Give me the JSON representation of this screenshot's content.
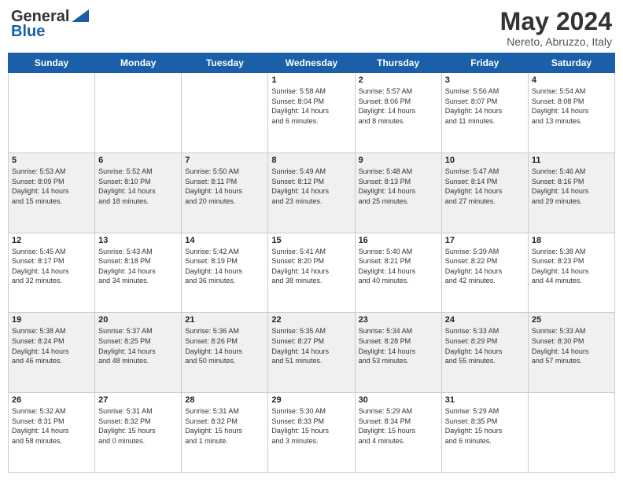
{
  "header": {
    "logo_general": "General",
    "logo_blue": "Blue",
    "month_title": "May 2024",
    "location": "Nereto, Abruzzo, Italy"
  },
  "weekdays": [
    "Sunday",
    "Monday",
    "Tuesday",
    "Wednesday",
    "Thursday",
    "Friday",
    "Saturday"
  ],
  "weeks": [
    {
      "shaded": false,
      "days": [
        {
          "day": "",
          "info": ""
        },
        {
          "day": "",
          "info": ""
        },
        {
          "day": "",
          "info": ""
        },
        {
          "day": "1",
          "info": "Sunrise: 5:58 AM\nSunset: 8:04 PM\nDaylight: 14 hours\nand 6 minutes."
        },
        {
          "day": "2",
          "info": "Sunrise: 5:57 AM\nSunset: 8:06 PM\nDaylight: 14 hours\nand 8 minutes."
        },
        {
          "day": "3",
          "info": "Sunrise: 5:56 AM\nSunset: 8:07 PM\nDaylight: 14 hours\nand 11 minutes."
        },
        {
          "day": "4",
          "info": "Sunrise: 5:54 AM\nSunset: 8:08 PM\nDaylight: 14 hours\nand 13 minutes."
        }
      ]
    },
    {
      "shaded": true,
      "days": [
        {
          "day": "5",
          "info": "Sunrise: 5:53 AM\nSunset: 8:09 PM\nDaylight: 14 hours\nand 15 minutes."
        },
        {
          "day": "6",
          "info": "Sunrise: 5:52 AM\nSunset: 8:10 PM\nDaylight: 14 hours\nand 18 minutes."
        },
        {
          "day": "7",
          "info": "Sunrise: 5:50 AM\nSunset: 8:11 PM\nDaylight: 14 hours\nand 20 minutes."
        },
        {
          "day": "8",
          "info": "Sunrise: 5:49 AM\nSunset: 8:12 PM\nDaylight: 14 hours\nand 23 minutes."
        },
        {
          "day": "9",
          "info": "Sunrise: 5:48 AM\nSunset: 8:13 PM\nDaylight: 14 hours\nand 25 minutes."
        },
        {
          "day": "10",
          "info": "Sunrise: 5:47 AM\nSunset: 8:14 PM\nDaylight: 14 hours\nand 27 minutes."
        },
        {
          "day": "11",
          "info": "Sunrise: 5:46 AM\nSunset: 8:16 PM\nDaylight: 14 hours\nand 29 minutes."
        }
      ]
    },
    {
      "shaded": false,
      "days": [
        {
          "day": "12",
          "info": "Sunrise: 5:45 AM\nSunset: 8:17 PM\nDaylight: 14 hours\nand 32 minutes."
        },
        {
          "day": "13",
          "info": "Sunrise: 5:43 AM\nSunset: 8:18 PM\nDaylight: 14 hours\nand 34 minutes."
        },
        {
          "day": "14",
          "info": "Sunrise: 5:42 AM\nSunset: 8:19 PM\nDaylight: 14 hours\nand 36 minutes."
        },
        {
          "day": "15",
          "info": "Sunrise: 5:41 AM\nSunset: 8:20 PM\nDaylight: 14 hours\nand 38 minutes."
        },
        {
          "day": "16",
          "info": "Sunrise: 5:40 AM\nSunset: 8:21 PM\nDaylight: 14 hours\nand 40 minutes."
        },
        {
          "day": "17",
          "info": "Sunrise: 5:39 AM\nSunset: 8:22 PM\nDaylight: 14 hours\nand 42 minutes."
        },
        {
          "day": "18",
          "info": "Sunrise: 5:38 AM\nSunset: 8:23 PM\nDaylight: 14 hours\nand 44 minutes."
        }
      ]
    },
    {
      "shaded": true,
      "days": [
        {
          "day": "19",
          "info": "Sunrise: 5:38 AM\nSunset: 8:24 PM\nDaylight: 14 hours\nand 46 minutes."
        },
        {
          "day": "20",
          "info": "Sunrise: 5:37 AM\nSunset: 8:25 PM\nDaylight: 14 hours\nand 48 minutes."
        },
        {
          "day": "21",
          "info": "Sunrise: 5:36 AM\nSunset: 8:26 PM\nDaylight: 14 hours\nand 50 minutes."
        },
        {
          "day": "22",
          "info": "Sunrise: 5:35 AM\nSunset: 8:27 PM\nDaylight: 14 hours\nand 51 minutes."
        },
        {
          "day": "23",
          "info": "Sunrise: 5:34 AM\nSunset: 8:28 PM\nDaylight: 14 hours\nand 53 minutes."
        },
        {
          "day": "24",
          "info": "Sunrise: 5:33 AM\nSunset: 8:29 PM\nDaylight: 14 hours\nand 55 minutes."
        },
        {
          "day": "25",
          "info": "Sunrise: 5:33 AM\nSunset: 8:30 PM\nDaylight: 14 hours\nand 57 minutes."
        }
      ]
    },
    {
      "shaded": false,
      "days": [
        {
          "day": "26",
          "info": "Sunrise: 5:32 AM\nSunset: 8:31 PM\nDaylight: 14 hours\nand 58 minutes."
        },
        {
          "day": "27",
          "info": "Sunrise: 5:31 AM\nSunset: 8:32 PM\nDaylight: 15 hours\nand 0 minutes."
        },
        {
          "day": "28",
          "info": "Sunrise: 5:31 AM\nSunset: 8:32 PM\nDaylight: 15 hours\nand 1 minute."
        },
        {
          "day": "29",
          "info": "Sunrise: 5:30 AM\nSunset: 8:33 PM\nDaylight: 15 hours\nand 3 minutes."
        },
        {
          "day": "30",
          "info": "Sunrise: 5:29 AM\nSunset: 8:34 PM\nDaylight: 15 hours\nand 4 minutes."
        },
        {
          "day": "31",
          "info": "Sunrise: 5:29 AM\nSunset: 8:35 PM\nDaylight: 15 hours\nand 6 minutes."
        },
        {
          "day": "",
          "info": ""
        }
      ]
    }
  ]
}
